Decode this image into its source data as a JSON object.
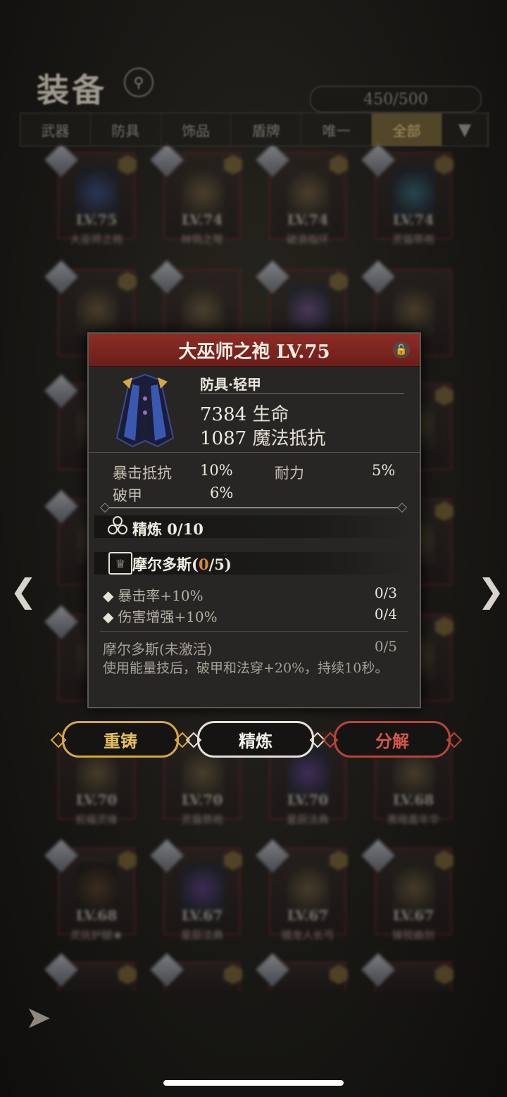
{
  "header": {
    "title": "装备",
    "capacity": "450/500"
  },
  "tabs": [
    {
      "label": "武器",
      "active": false
    },
    {
      "label": "防具",
      "active": false
    },
    {
      "label": "饰品",
      "active": false
    },
    {
      "label": "盾牌",
      "active": false
    },
    {
      "label": "唯一",
      "active": false
    },
    {
      "label": "全部",
      "active": true
    }
  ],
  "grid": [
    {
      "level": "LV.75",
      "name": "大巫师之袍"
    },
    {
      "level": "LV.74",
      "name": "林鸮之弩"
    },
    {
      "level": "LV.74",
      "name": "破浪指环"
    },
    {
      "level": "LV.74",
      "name": "灵猫祭袍"
    },
    {
      "level": "LV.70",
      "name": "祝福灵锋"
    },
    {
      "level": "LV.70",
      "name": "灵猫祭袍"
    },
    {
      "level": "LV.70",
      "name": "星辰法典"
    },
    {
      "level": "LV.68",
      "name": "黑暗嘉年华"
    },
    {
      "level": "LV.68",
      "name": "灵抚护腿★"
    },
    {
      "level": "LV.67",
      "name": "星辰法典"
    },
    {
      "level": "LV.67",
      "name": "猎龙人长弓"
    },
    {
      "level": "LV.67",
      "name": "锋锐曲剑"
    }
  ],
  "popup": {
    "title": "大巫师之袍 LV.75",
    "subtype": "防具·轻甲",
    "main_stats": [
      {
        "value": "7384",
        "label": "生命"
      },
      {
        "value": "1087",
        "label": "魔法抵抗"
      }
    ],
    "sub_stats": [
      {
        "label": "暴击抵抗",
        "value": "10%"
      },
      {
        "label": "耐力",
        "value": "5%"
      },
      {
        "label": "破甲",
        "value": "6%"
      }
    ],
    "refine": "精炼 0/10",
    "set": {
      "name": "摩尔多斯(",
      "count": "0",
      "total": "/5)"
    },
    "set_bonuses": [
      {
        "text": "暴击率+10%",
        "progress": "0/3"
      },
      {
        "text": "伤害增强+10%",
        "progress": "0/4"
      }
    ],
    "inactive_label": "摩尔多斯(未激活)",
    "inactive_progress": "0/5",
    "description": "使用能量技后，破甲和法穿+20%，持续10秒。"
  },
  "actions": {
    "reforge": "重铸",
    "refine": "精炼",
    "decompose": "分解"
  },
  "colors": {
    "reforge": "#d4a842",
    "refine": "#e5e1da",
    "decompose": "#b8443a",
    "header": "#8c2d25"
  }
}
